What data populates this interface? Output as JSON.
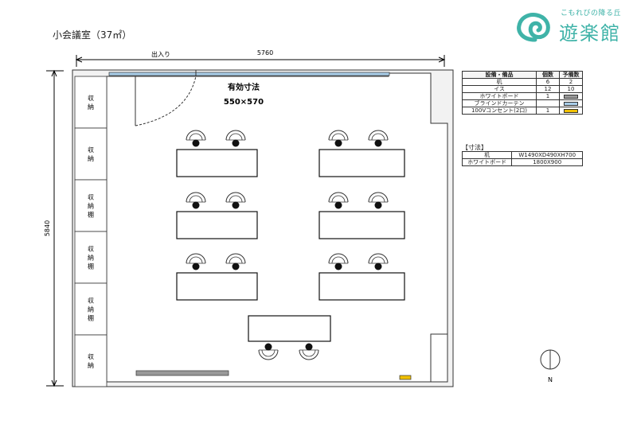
{
  "room_title": "小会議室（37㎡）",
  "logo": {
    "tagline": "こもれびの降る丘",
    "name": "遊楽館",
    "icon": "spiral-logo-icon",
    "color": "#3fb3a8"
  },
  "plan": {
    "width_dim": "5760",
    "height_dim": "5840",
    "entrance_label": "出入り",
    "effective_title": "有効寸法",
    "effective_size": "550×570",
    "north_label": "N",
    "storage": [
      "収\n納",
      "収\n納",
      "収\n納\n棚",
      "収\n納\n棚",
      "収\n納\n棚",
      "収\n納"
    ]
  },
  "equipment_table": {
    "headers": [
      "設備・備品",
      "個数",
      "予備数"
    ],
    "rows": [
      {
        "name": "机",
        "count": "6",
        "spare": "2",
        "swatch": null
      },
      {
        "name": "イス",
        "count": "12",
        "spare": "10",
        "swatch": null
      },
      {
        "name": "ホワイトボード",
        "count": "1",
        "spare": "",
        "swatch": "#999999"
      },
      {
        "name": "ブラインドカーテン",
        "count": "",
        "spare": "",
        "swatch": "#a8cde8"
      },
      {
        "name": "100Vコンセント(2口)",
        "count": "1",
        "spare": "",
        "swatch": "#f0c000"
      }
    ]
  },
  "dimensions": {
    "title": "【寸法】",
    "rows": [
      {
        "item": "机",
        "size": "W1490XD490XH700"
      },
      {
        "item": "ホワイトボード",
        "size": "1800X900"
      }
    ]
  },
  "colors": {
    "blind": "#a8cde8",
    "whiteboard": "#999999",
    "outlet": "#f0c000"
  }
}
